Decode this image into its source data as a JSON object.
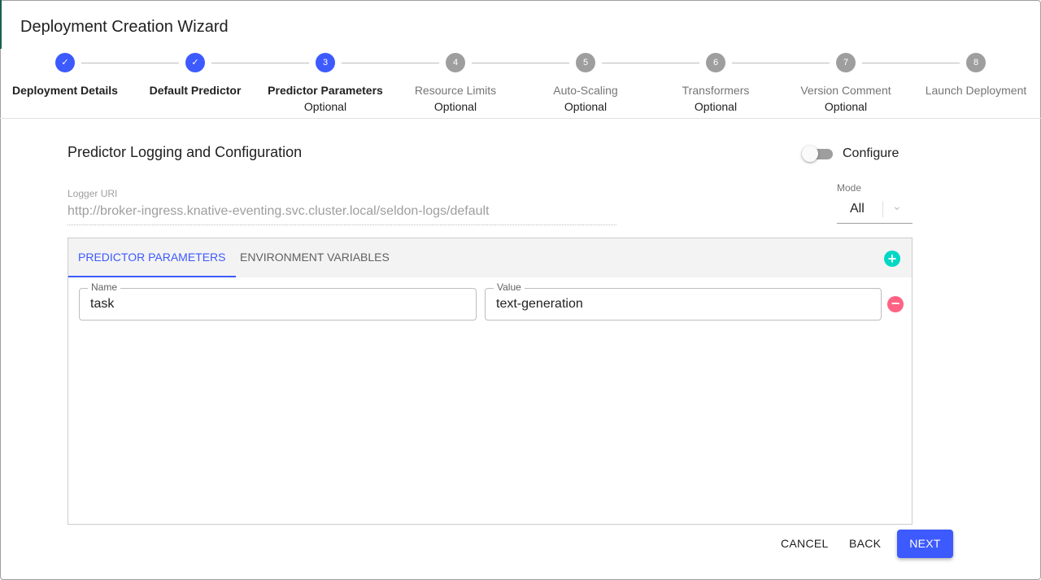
{
  "title": "Deployment Creation Wizard",
  "steps": [
    {
      "num": "1",
      "label": "Deployment Details",
      "status": "done"
    },
    {
      "num": "2",
      "label": "Default Predictor",
      "status": "done"
    },
    {
      "num": "3",
      "label": "Predictor Parameters",
      "optional": "Optional",
      "status": "active"
    },
    {
      "num": "4",
      "label": "Resource Limits",
      "optional": "Optional",
      "status": "pending"
    },
    {
      "num": "5",
      "label": "Auto-Scaling",
      "optional": "Optional",
      "status": "pending"
    },
    {
      "num": "6",
      "label": "Transformers",
      "optional": "Optional",
      "status": "pending"
    },
    {
      "num": "7",
      "label": "Version Comment",
      "optional": "Optional",
      "status": "pending"
    },
    {
      "num": "8",
      "label": "Launch Deployment",
      "status": "pending"
    }
  ],
  "section": {
    "title": "Predictor Logging and Configuration",
    "configure_label": "Configure",
    "configure_on": false
  },
  "logger": {
    "label": "Logger URI",
    "value": "http://broker-ingress.knative-eventing.svc.cluster.local/seldon-logs/default"
  },
  "mode": {
    "label": "Mode",
    "value": "All"
  },
  "tabs": [
    {
      "label": "PREDICTOR PARAMETERS",
      "active": true
    },
    {
      "label": "ENVIRONMENT VARIABLES",
      "active": false
    }
  ],
  "params": [
    {
      "name_label": "Name",
      "name": "task",
      "value_label": "Value",
      "value": "text-generation"
    }
  ],
  "buttons": {
    "cancel": "CANCEL",
    "back": "BACK",
    "next": "NEXT"
  },
  "colors": {
    "primary": "#3d5afe",
    "add": "#00d8c6",
    "remove": "#ff6384"
  }
}
